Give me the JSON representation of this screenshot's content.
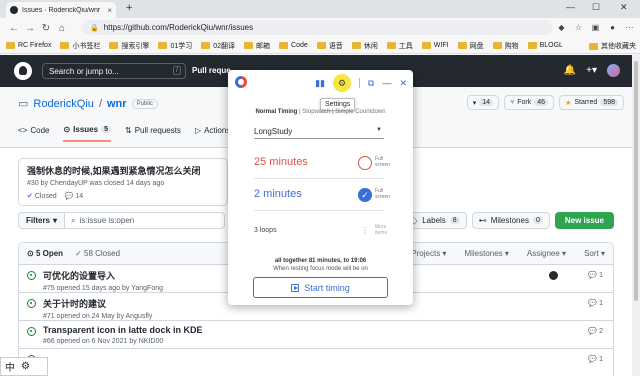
{
  "browser": {
    "tab_title": "Issues · RoderickQiu/wnr",
    "tab_close": "×",
    "new_tab": "+",
    "url": "https://github.com/RoderickQiu/wnr/issues",
    "window_controls": [
      "—",
      "☐",
      "✕"
    ]
  },
  "bookmarks": {
    "items": [
      "RC Firefox",
      "小书签栏",
      "搜索引擎",
      "01学习",
      "02翻译",
      "邮箱",
      "Code",
      "语音",
      "休闲",
      "工具",
      "WIFI",
      "网盘",
      "购物",
      "BLOGL"
    ],
    "other": "其他收藏夹"
  },
  "github": {
    "search_placeholder": "Search or jump to...",
    "search_shortcut": "/",
    "nav_item": "Pull reque",
    "plus": "+▾"
  },
  "repo": {
    "owner": "RoderickQiu",
    "separator": "/",
    "name": "wnr",
    "visibility": "Public",
    "notifications_count": "14",
    "fork_label": "Fork",
    "fork_count": "46",
    "starred_label": "Starred",
    "star_count": "598",
    "tabs": [
      {
        "label": "Code"
      },
      {
        "label": "Issues",
        "count": "5"
      },
      {
        "label": "Pull requests"
      },
      {
        "label": "Actions"
      }
    ]
  },
  "pinned_issue": {
    "title": "强制休息的时候,如果遇到紧急情况怎么关闭",
    "meta": "#30 by ChendayUP was closed 14 days ago",
    "state": "Closed",
    "comments": "14"
  },
  "filters": {
    "button": "Filters",
    "query": "is:issue is:open",
    "labels_label": "Labels",
    "labels_count": "8",
    "milestones_label": "Milestones",
    "milestones_count": "0",
    "new_issue": "New issue"
  },
  "issue_list": {
    "open": "5 Open",
    "closed": "58 Closed",
    "sorts": [
      "Projects ▾",
      "Milestones ▾",
      "Assignee ▾",
      "Sort ▾"
    ],
    "rows": [
      {
        "title": "可优化的设置导入",
        "meta": "#75 opened 15 days ago by YangFong",
        "comments": "1"
      },
      {
        "title": "关于计时的建议",
        "meta": "#71 opened on 24 May by Angusfly",
        "comments": "1"
      },
      {
        "title": "Transparent icon in latte dock in KDE",
        "meta": "#66 opened on 6 Nov 2021 by NKID00",
        "comments": "2"
      },
      {
        "title": "",
        "meta": "",
        "comments": "1"
      }
    ]
  },
  "ime": {
    "mode": "中",
    "gear": "⚙"
  },
  "popup": {
    "tooltip": "Settings",
    "modes": {
      "normal": "Normal Timing",
      "stopwatch": "Stopwatch",
      "simple": "Simple Countdown"
    },
    "preset": "LongStudy",
    "work": {
      "value": "25 minutes",
      "label": "Full screen"
    },
    "rest": {
      "value": "2 minutes",
      "label": "Full screen"
    },
    "loops": {
      "value": "3 loops",
      "label": "More items"
    },
    "summary1": "all together 81 minutes, to 19:06",
    "summary2": "When resting focus mode will be on",
    "start": "Start timing"
  }
}
